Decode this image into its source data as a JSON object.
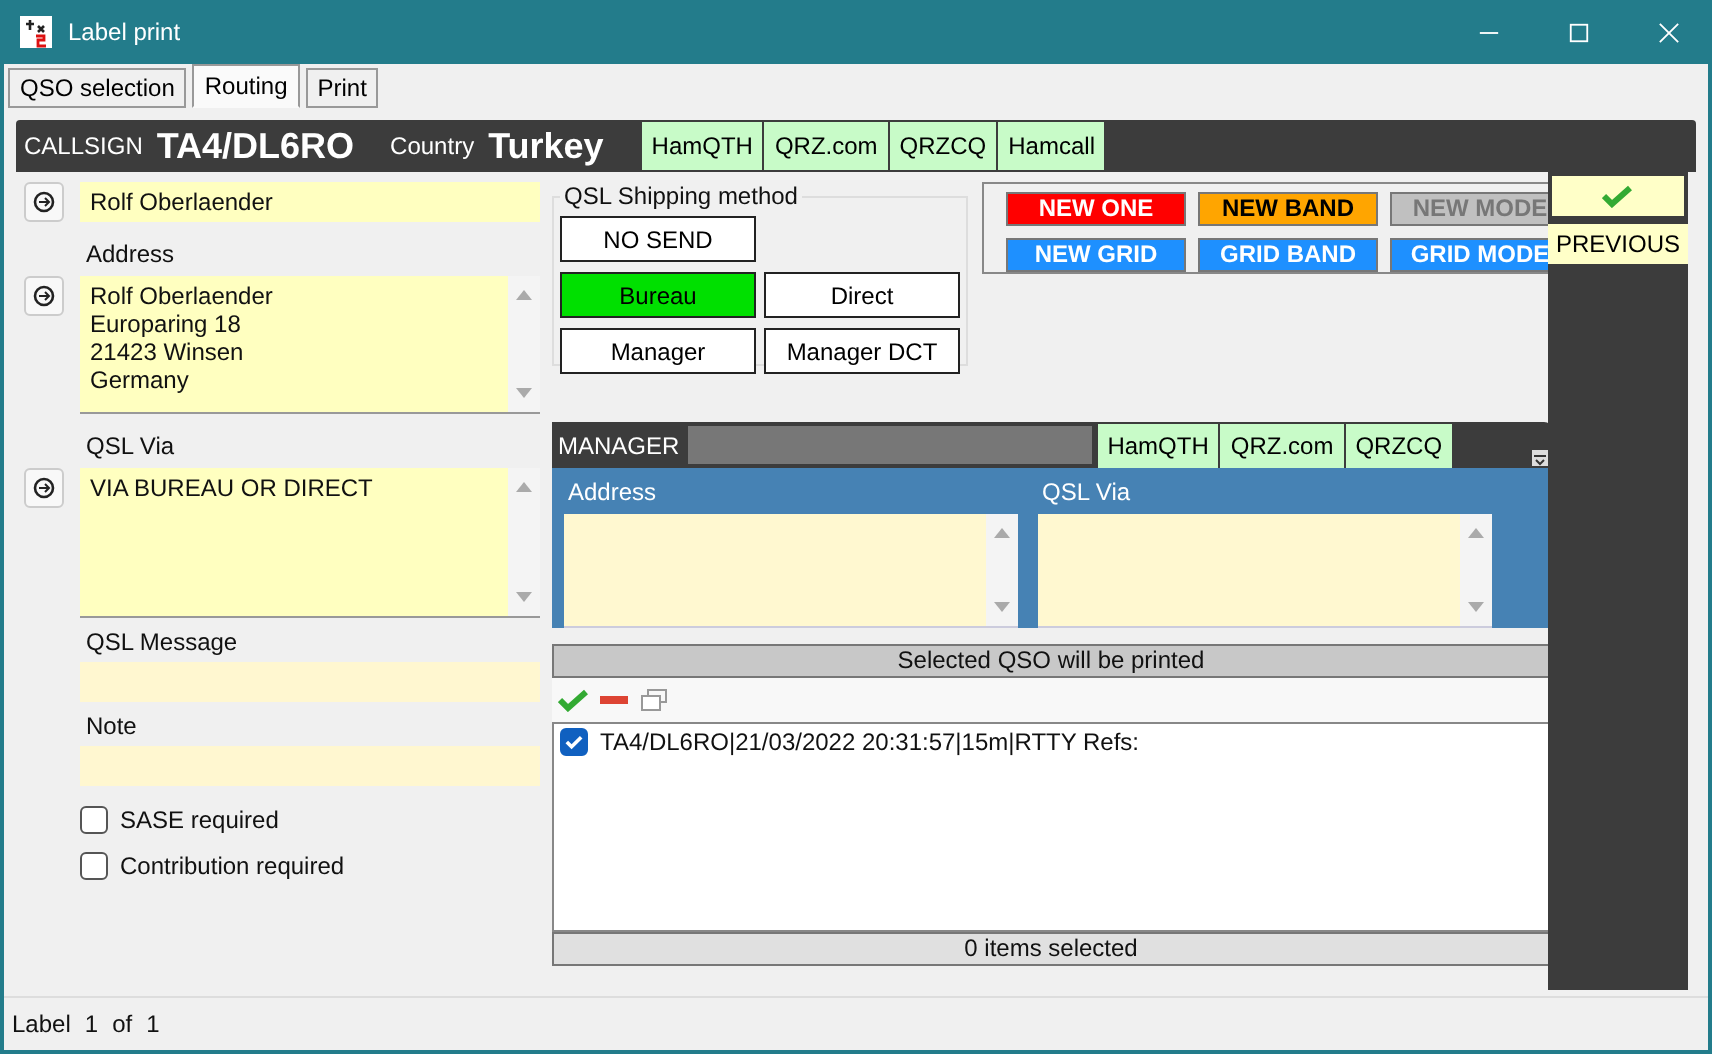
{
  "window": {
    "title": "Label print"
  },
  "tabs": [
    {
      "label": "QSO selection",
      "selected": false
    },
    {
      "label": "Routing",
      "selected": true
    },
    {
      "label": "Print",
      "selected": false
    }
  ],
  "header": {
    "callsign_label": "CALLSIGN",
    "callsign": "TA4/DL6RO",
    "country_label": "Country",
    "country": "Turkey",
    "lookup_links": [
      "HamQTH",
      "QRZ.com",
      "QRZCQ",
      "Hamcall"
    ]
  },
  "name": "Rolf Oberlaender",
  "address": {
    "label": "Address",
    "lines": [
      "Rolf Oberlaender",
      "Europaring 18",
      "21423 Winsen",
      "Germany"
    ]
  },
  "qsl_via": {
    "label": "QSL Via",
    "value": "VIA BUREAU OR DIRECT"
  },
  "qsl_message": {
    "label": "QSL Message"
  },
  "note": {
    "label": "Note"
  },
  "options": [
    {
      "label": "SASE required",
      "checked": false
    },
    {
      "label": "Contribution required",
      "checked": false
    }
  ],
  "shipping": {
    "title": "QSL Shipping method",
    "buttons": [
      {
        "label": "NO SEND",
        "selected": false
      },
      {
        "label": "Bureau",
        "selected": true
      },
      {
        "label": "Direct",
        "selected": false
      },
      {
        "label": "Manager",
        "selected": false
      },
      {
        "label": "Manager DCT",
        "selected": false
      }
    ]
  },
  "badges": [
    {
      "label": "NEW ONE",
      "color": "#ff0000",
      "disabled": false
    },
    {
      "label": "NEW BAND",
      "color": "#ffa500",
      "disabled": false
    },
    {
      "label": "NEW MODE",
      "color": "#c0c0c0",
      "disabled": true
    },
    {
      "label": "NEW GRID",
      "color": "#1e90ff",
      "disabled": false
    },
    {
      "label": "GRID BAND",
      "color": "#1e90ff",
      "disabled": false
    },
    {
      "label": "GRID MODE",
      "color": "#1e90ff",
      "disabled": false
    }
  ],
  "side": {
    "previous": "PREVIOUS"
  },
  "manager": {
    "label": "MANAGER",
    "lookup_links": [
      "HamQTH",
      "QRZ.com",
      "QRZCQ"
    ],
    "address_label": "Address",
    "qsl_via_label": "QSL Via"
  },
  "qso_list": {
    "header": "Selected QSO will be printed",
    "items": [
      {
        "text": "TA4/DL6RO|21/03/2022 20:31:57|15m|RTTY Refs:",
        "checked": true
      }
    ],
    "footer": "0 items selected"
  },
  "status_bar": {
    "label": "Label",
    "current": "1",
    "of": "of",
    "total": "1"
  }
}
